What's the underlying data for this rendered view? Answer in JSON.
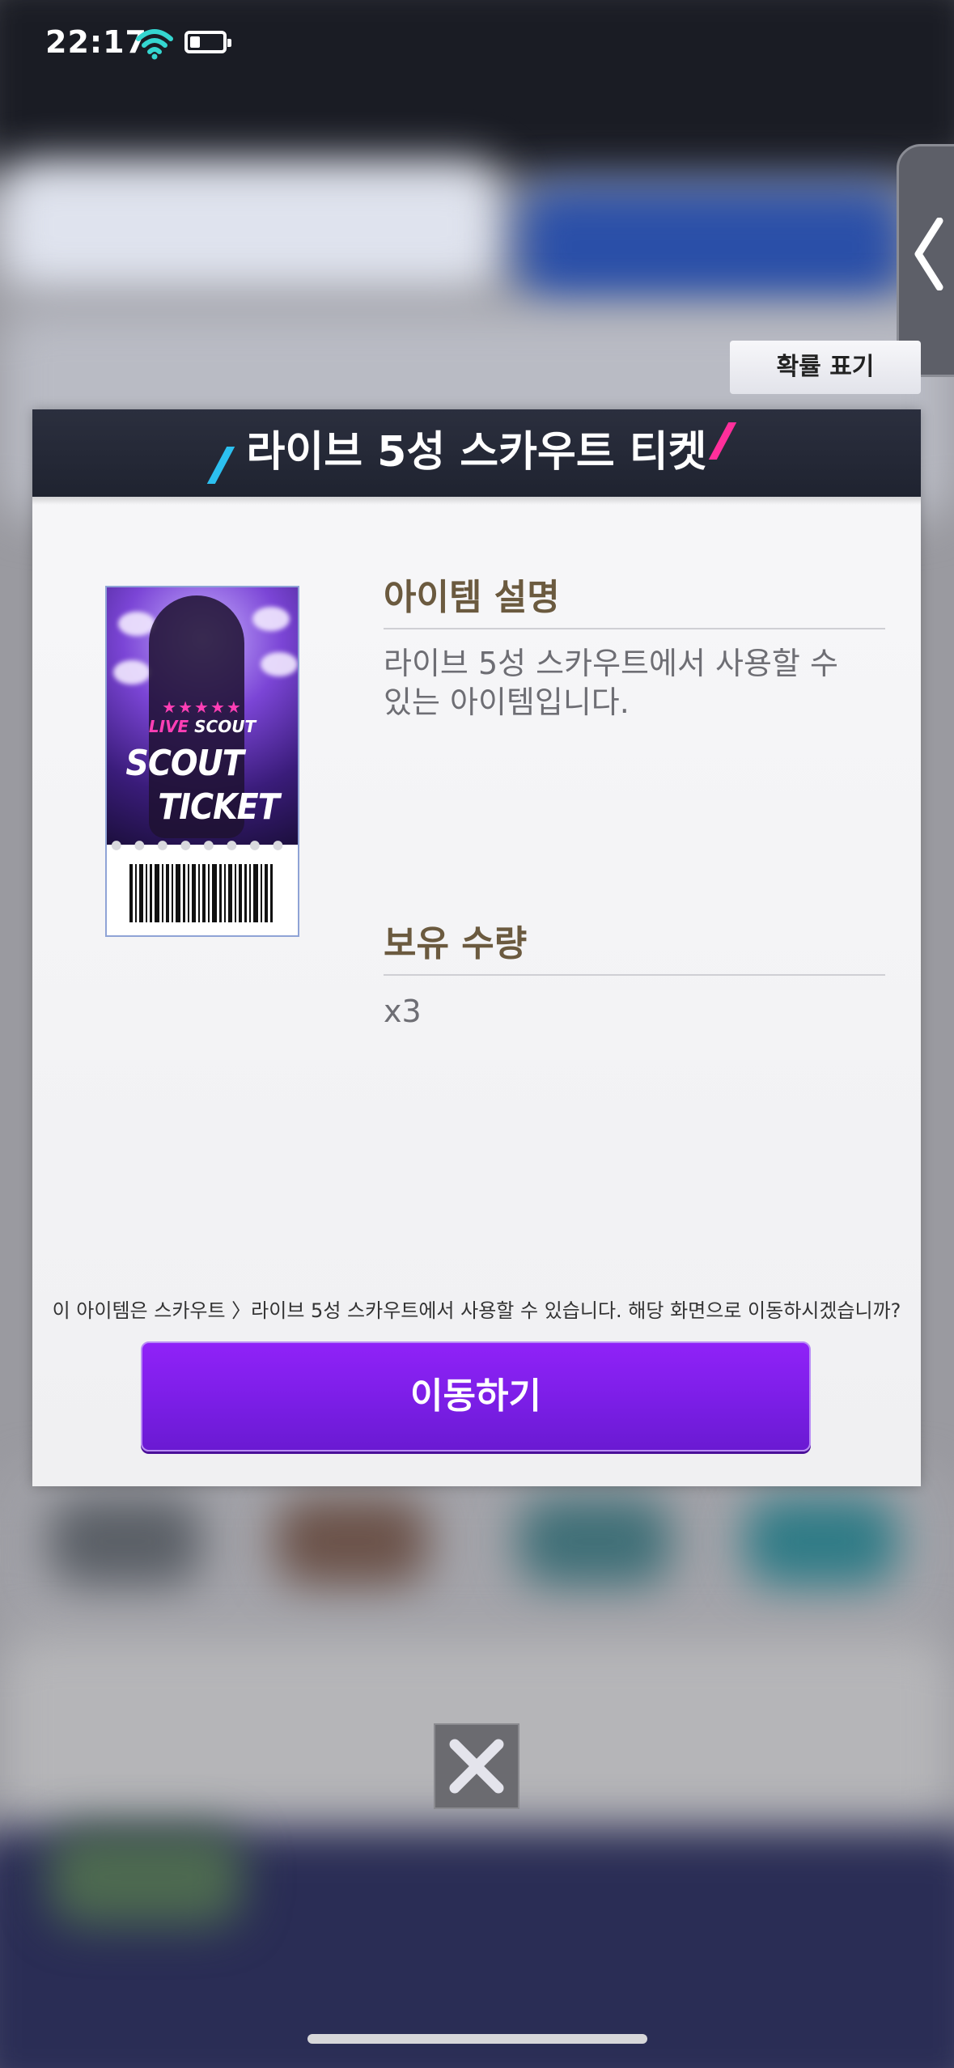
{
  "status_bar": {
    "time": "22:17",
    "battery_level": 0.3
  },
  "probability_button": {
    "label": "확률 표기"
  },
  "dialog": {
    "title": "라이브 5성 스카우트 티켓",
    "ticket_image": {
      "stars": "★★★★★",
      "live_text_1": "LIVE",
      "live_text_2": "SCOUT",
      "big_line_1": "SCOUT",
      "big_line_2": "TICKET"
    },
    "description": {
      "heading": "아이템 설명",
      "line_1": "라이브 5성 스카우트에서 사용할 수",
      "line_2": "있는 아이템입니다."
    },
    "quantity": {
      "heading": "보유 수량",
      "value": "x3"
    },
    "notice": "이 아이템은 스카우트 〉라이브 5성 스카우트에서 사용할 수 있습니다. 해당 화면으로 이동하시겠습니까?",
    "move_button": {
      "label": "이동하기"
    }
  },
  "colors": {
    "header": "#1f2330",
    "button": "#7b1ee6",
    "section_title": "#6b5a3f",
    "slash_left": "#2cc0f0",
    "slash_right": "#ff2f9b"
  },
  "icons": [
    "wifi-icon",
    "battery-icon",
    "chevron-left-icon",
    "close-icon"
  ]
}
